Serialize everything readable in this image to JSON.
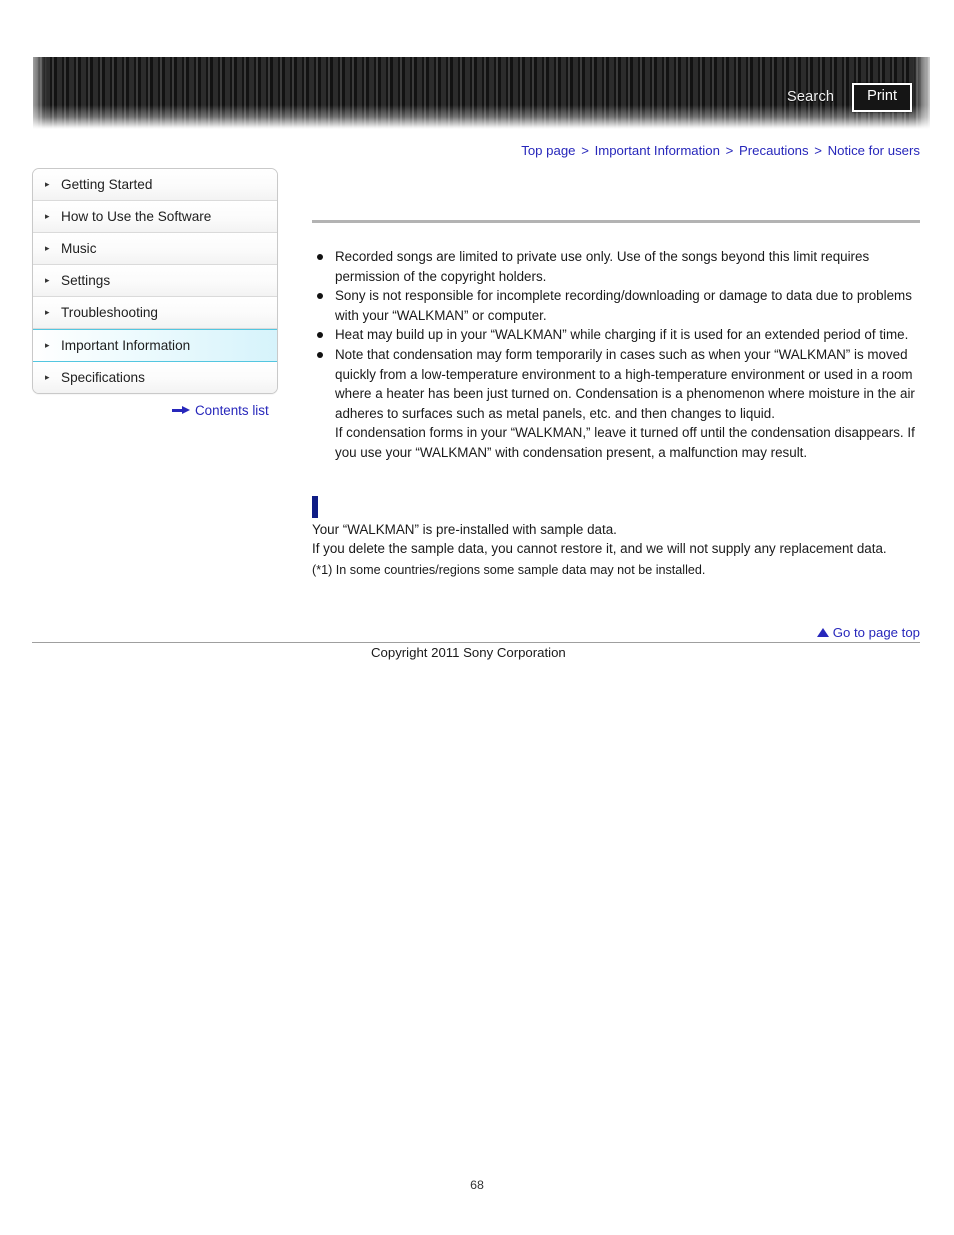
{
  "header": {
    "search_label": "Search",
    "print_label": "Print"
  },
  "breadcrumb": {
    "items": [
      {
        "label": "Top page"
      },
      {
        "label": "Important Information"
      },
      {
        "label": "Precautions"
      },
      {
        "label": "Notice for users"
      }
    ],
    "separator": ">"
  },
  "sidebar": {
    "items": [
      {
        "label": "Getting Started",
        "active": false
      },
      {
        "label": "How to Use the Software",
        "active": false
      },
      {
        "label": "Music",
        "active": false
      },
      {
        "label": "Settings",
        "active": false
      },
      {
        "label": "Troubleshooting",
        "active": false
      },
      {
        "label": "Important Information",
        "active": true
      },
      {
        "label": "Specifications",
        "active": false
      }
    ],
    "contents_list_label": "Contents list",
    "arrow_glyph": "▸"
  },
  "main": {
    "bullets": [
      {
        "paragraphs": [
          "Recorded songs are limited to private use only. Use of the songs beyond this limit requires permission of the copyright holders."
        ]
      },
      {
        "paragraphs": [
          "Sony is not responsible for incomplete recording/downloading or damage to data due to problems with your “WALKMAN” or computer."
        ]
      },
      {
        "paragraphs": [
          "Heat may build up in your “WALKMAN” while charging if it is used for an extended period of time."
        ]
      },
      {
        "paragraphs": [
          "Note that condensation may form temporarily in cases such as when your “WALKMAN” is moved quickly from a low-temperature environment to a high-temperature environment or used in a room where a heater has been just turned on. Condensation is a phenomenon where moisture in the air adheres to surfaces such as metal panels, etc. and then changes to liquid.",
          "If condensation forms in your “WALKMAN,” leave it turned off until the condensation disappears. If you use your “WALKMAN” with condensation present, a malfunction may result."
        ]
      }
    ],
    "sample_data": {
      "line1": "Your “WALKMAN” is pre-installed with sample data.",
      "line2": "If you delete the sample data, you cannot restore it, and we will not supply any replacement data.",
      "note": "(*1) In some countries/regions some sample data may not be installed."
    }
  },
  "footer": {
    "goto_top_label": "Go to page top",
    "copyright": "Copyright 2011 Sony Corporation",
    "page_number": "68"
  }
}
